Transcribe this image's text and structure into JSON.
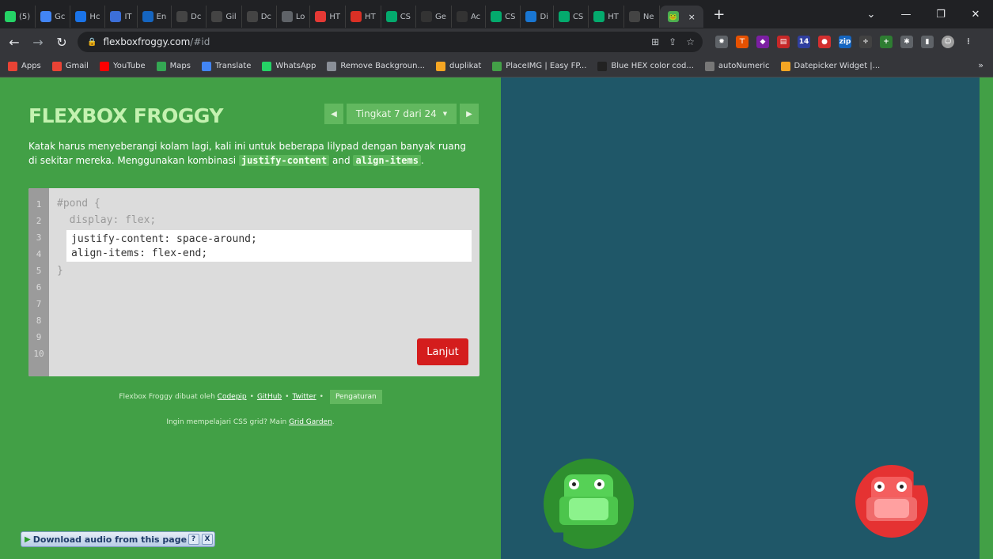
{
  "browser": {
    "tabs": [
      {
        "label": "(5)",
        "icon": "whatsapp-icon",
        "color": "#25d366"
      },
      {
        "label": "Gc",
        "icon": "translate-icon",
        "color": "#4285f4"
      },
      {
        "label": "Hc",
        "icon": "sync-icon",
        "color": "#1a73e8"
      },
      {
        "label": "IT",
        "icon": "globe-icon",
        "color": "#3c6fd8"
      },
      {
        "label": "En",
        "icon": "x-icon",
        "color": "#1565c0"
      },
      {
        "label": "Dc",
        "icon": "github-icon",
        "color": "#444444"
      },
      {
        "label": "Gil",
        "icon": "github-icon",
        "color": "#444444"
      },
      {
        "label": "Dc",
        "icon": "github-icon",
        "color": "#444444"
      },
      {
        "label": "Lo",
        "icon": "page-icon",
        "color": "#5f6368"
      },
      {
        "label": "HT",
        "icon": "v-icon",
        "color": "#e53935"
      },
      {
        "label": "HT",
        "icon": "record-icon",
        "color": "#d93025"
      },
      {
        "label": "CS",
        "icon": "w3-icon",
        "color": "#04aa6d"
      },
      {
        "label": "Ge",
        "icon": "m-icon",
        "color": "#333333"
      },
      {
        "label": "Ac",
        "icon": "m-icon",
        "color": "#333333"
      },
      {
        "label": "CS",
        "icon": "w3-icon",
        "color": "#04aa6d"
      },
      {
        "label": "Di",
        "icon": "people-icon",
        "color": "#1976d2"
      },
      {
        "label": "CS",
        "icon": "w3-icon",
        "color": "#04aa6d"
      },
      {
        "label": "HT",
        "icon": "w3-icon",
        "color": "#04aa6d"
      },
      {
        "label": "Ne",
        "icon": "github-icon",
        "color": "#444444"
      }
    ],
    "active_tab": {
      "icon": "frog-icon",
      "color": "#4caf50",
      "close": "×"
    },
    "new_tab": "+",
    "url_host": "flexboxfroggy.com",
    "url_path": "/#id",
    "bookmarks": [
      {
        "label": "Apps",
        "icon": "apps-grid-icon",
        "color": "#ea4335"
      },
      {
        "label": "Gmail",
        "icon": "gmail-icon",
        "color": "#ea4335"
      },
      {
        "label": "YouTube",
        "icon": "youtube-icon",
        "color": "#ff0000"
      },
      {
        "label": "Maps",
        "icon": "maps-icon",
        "color": "#34a853"
      },
      {
        "label": "Translate",
        "icon": "translate-icon",
        "color": "#4285f4"
      },
      {
        "label": "WhatsApp",
        "icon": "whatsapp-icon",
        "color": "#25d366"
      },
      {
        "label": "Remove Backgroun...",
        "icon": "removebg-icon",
        "color": "#8a8f98"
      },
      {
        "label": "duplikat",
        "icon": "duplikat-icon",
        "color": "#f5a623"
      },
      {
        "label": "PlaceIMG | Easy FP...",
        "icon": "placeimg-icon",
        "color": "#43a047"
      },
      {
        "label": "Blue HEX color cod...",
        "icon": "hex-icon",
        "color": "#222222"
      },
      {
        "label": "autoNumeric",
        "icon": "autonumeric-icon",
        "color": "#777777"
      },
      {
        "label": "Datepicker Widget |...",
        "icon": "jquery-ui-icon",
        "color": "#f5a623"
      }
    ],
    "bookmarks_more": "»"
  },
  "game": {
    "logo": "FLEXBOX FROGGY",
    "level_label": "Tingkat 7 dari 24",
    "instructions_before": "Katak harus menyeberangi kolam lagi, kali ini untuk beberapa lilypad dengan banyak ruang di sekitar mereka. Menggunakan kombinasi ",
    "code_justify": "justify-content",
    "instructions_and": " and ",
    "code_align": "align-items",
    "instructions_end": ".",
    "line_numbers": [
      "1",
      "2",
      "3",
      "4",
      "5",
      "6",
      "7",
      "8",
      "9",
      "10"
    ],
    "code_line1": "#pond {",
    "code_line2": "  display: flex;",
    "input_line1": "justify-content: space-around;",
    "input_line2": "align-items: flex-end;",
    "code_close": "}",
    "next_button": "Lanjut",
    "credits_prefix": "Flexbox Froggy dibuat oleh",
    "credit_codepip": "Codepip",
    "credit_github": "GitHub",
    "credit_twitter": "Twitter",
    "bullet": "•",
    "settings_button": "Pengaturan",
    "grid_prefix": "Ingin mempelajari CSS grid? Main ",
    "grid_link": "Grid Garden",
    "grid_end": "."
  },
  "audio_widget": {
    "label": "Download audio from this page",
    "help": "?",
    "close": "X"
  },
  "colors": {
    "green_frog": "#3bb43b",
    "red_frog": "#e53232",
    "pond": "#1f5768"
  }
}
